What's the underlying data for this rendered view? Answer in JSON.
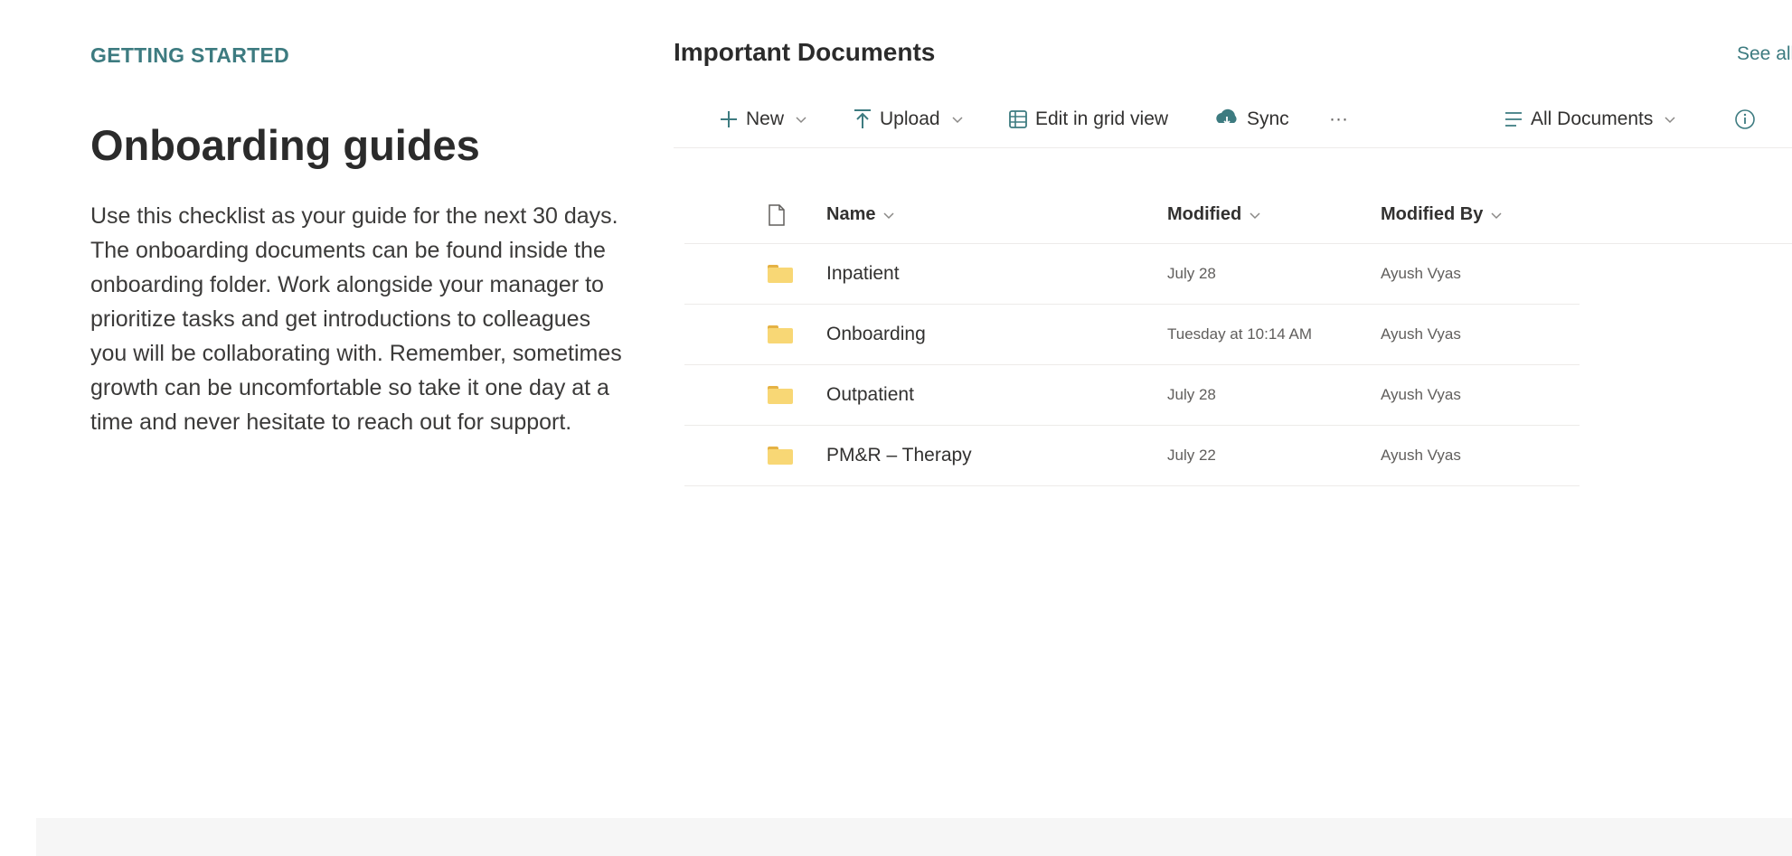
{
  "left": {
    "eyebrow": "GETTING STARTED",
    "title": "Onboarding guides",
    "description": "Use this checklist as your guide for the next 30 days. The onboarding documents can be found inside the onboarding folder. Work alongside your manager to prioritize tasks and get introductions to colleagues you will be collaborating with. Remember, sometimes growth can be uncomfortable so take it one day at a time and never hesitate to reach out for support."
  },
  "library": {
    "title": "Important Documents",
    "see_all": "See all",
    "toolbar": {
      "new_label": "New",
      "upload_label": "Upload",
      "grid_label": "Edit in grid view",
      "sync_label": "Sync",
      "more_label": "···",
      "view_label": "All Documents"
    },
    "columns": {
      "name": "Name",
      "modified": "Modified",
      "modified_by": "Modified By"
    },
    "rows": [
      {
        "name": "Inpatient",
        "modified": "July 28",
        "modified_by": "Ayush Vyas"
      },
      {
        "name": "Onboarding",
        "modified": "Tuesday at 10:14 AM",
        "modified_by": "Ayush Vyas"
      },
      {
        "name": "Outpatient",
        "modified": "July 28",
        "modified_by": "Ayush Vyas"
      },
      {
        "name": "PM&R – Therapy",
        "modified": "July 22",
        "modified_by": "Ayush Vyas"
      }
    ]
  },
  "colors": {
    "accent": "#3d7b80",
    "folder": "#f8d775"
  }
}
